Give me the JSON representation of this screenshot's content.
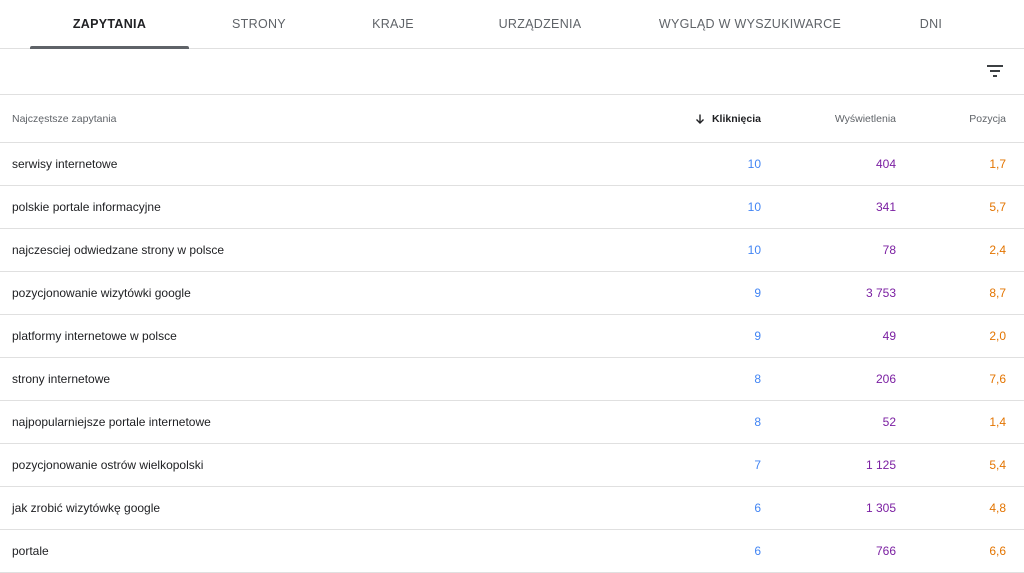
{
  "tabs": [
    {
      "label": "ZAPYTANIA",
      "active": true
    },
    {
      "label": "STRONY",
      "active": false
    },
    {
      "label": "KRAJE",
      "active": false
    },
    {
      "label": "URZĄDZENIA",
      "active": false
    },
    {
      "label": "WYGLĄD W WYSZUKIWARCE",
      "active": false
    },
    {
      "label": "DNI",
      "active": false
    }
  ],
  "toolbar": {
    "filter_icon": "filter-list-icon"
  },
  "table": {
    "headers": {
      "query": "Najczęstsze zapytania",
      "clicks": "Kliknięcia",
      "impressions": "Wyświetlenia",
      "position": "Pozycja"
    },
    "sorted_by": "clicks",
    "sort_direction": "descending",
    "rows": [
      {
        "query": "serwisy internetowe",
        "clicks": "10",
        "impressions": "404",
        "position": "1,7"
      },
      {
        "query": "polskie portale informacyjne",
        "clicks": "10",
        "impressions": "341",
        "position": "5,7"
      },
      {
        "query": "najczesciej odwiedzane strony w polsce",
        "clicks": "10",
        "impressions": "78",
        "position": "2,4"
      },
      {
        "query": "pozycjonowanie wizytówki google",
        "clicks": "9",
        "impressions": "3 753",
        "position": "8,7"
      },
      {
        "query": "platformy internetowe w polsce",
        "clicks": "9",
        "impressions": "49",
        "position": "2,0"
      },
      {
        "query": "strony internetowe",
        "clicks": "8",
        "impressions": "206",
        "position": "7,6"
      },
      {
        "query": "najpopularniejsze portale internetowe",
        "clicks": "8",
        "impressions": "52",
        "position": "1,4"
      },
      {
        "query": "pozycjonowanie ostrów wielkopolski",
        "clicks": "7",
        "impressions": "1 125",
        "position": "5,4"
      },
      {
        "query": "jak zrobić wizytówkę google",
        "clicks": "6",
        "impressions": "1 305",
        "position": "4,8"
      },
      {
        "query": "portale",
        "clicks": "6",
        "impressions": "766",
        "position": "6,6"
      }
    ]
  },
  "colors": {
    "clicks": "#4285f4",
    "impressions": "#7b1fa2",
    "position": "#e37400"
  }
}
